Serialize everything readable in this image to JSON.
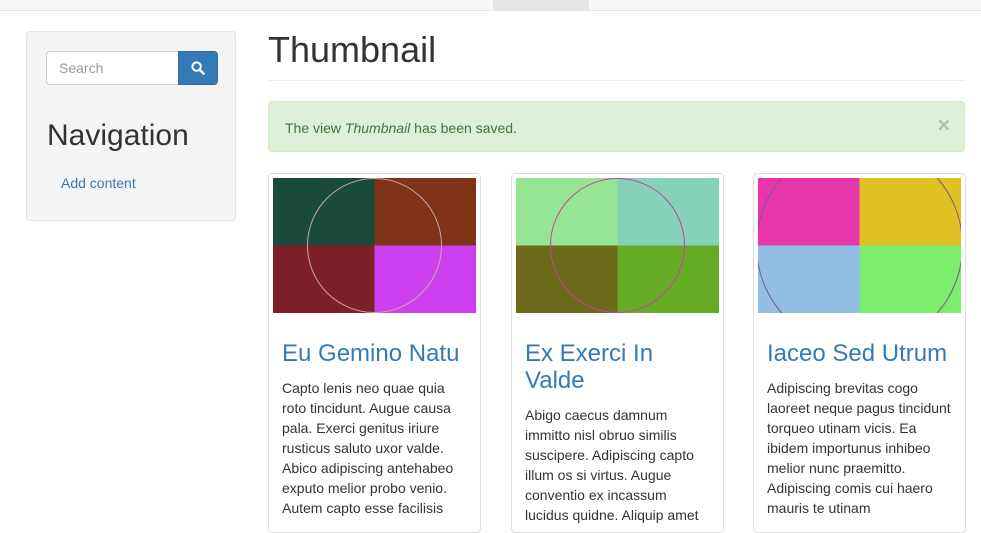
{
  "sidebar": {
    "search": {
      "placeholder": "Search"
    },
    "heading": "Navigation",
    "link": "Add content"
  },
  "main": {
    "title": "Thumbnail",
    "alert": {
      "prefix": "The view ",
      "view_name": "Thumbnail",
      "suffix": " has been saved.",
      "close": "×"
    },
    "cards": [
      {
        "title": "Eu Gemino Natu",
        "text": "Capto lenis neo quae quia roto tincidunt. Augue causa pala. Exerci genitus iriure rusticus saluto uxor valde. Abico adipiscing antehabeo exputo melior probo venio. Autem capto esse facilisis",
        "colors": [
          "#194a3a",
          "#7f3419",
          "#7d1f27",
          "#cc40f0"
        ],
        "circle_color": "#c9a6a6"
      },
      {
        "title": "Ex Exerci In Valde",
        "text": "Abigo caecus damnum immitto nisl obruo similis suscipere. Adipiscing capto illum os si virtus. Augue conventio ex incassum lucidus quidne. Aliquip amet",
        "colors": [
          "#96e592",
          "#86d2b9",
          "#6e6a1c",
          "#66ab25"
        ],
        "circle_color": "#c2469e"
      },
      {
        "title": "Iaceo Sed Utrum",
        "text": "Adipiscing brevitas cogo laoreet neque pagus tincidunt torqueo utinam vicis. Ea ibidem importunus inhibeo melior nunc praemitto. Adipiscing comis cui haero mauris te utinam",
        "colors": [
          "#e837ac",
          "#e1c024",
          "#92bde4",
          "#7ded6d"
        ],
        "circle_color": "#7b5a7b"
      }
    ]
  },
  "colors": {
    "primary": "#337ab7",
    "alert_bg": "#dff0d8",
    "alert_text": "#3c763d"
  }
}
